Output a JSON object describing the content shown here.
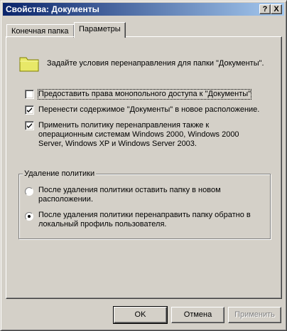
{
  "window": {
    "title": "Свойства: Документы",
    "help_button": "?",
    "close_button": "X"
  },
  "tabs": [
    {
      "label": "Конечная папка",
      "selected": false
    },
    {
      "label": "Параметры",
      "selected": true
    }
  ],
  "header": {
    "icon": "folder-icon",
    "text": "Задайте условия перенаправления для папки \"Документы\"."
  },
  "options": [
    {
      "label": "Предоставить права монопольного доступа к \"Документы\"",
      "checked": false
    },
    {
      "label": "Перенести содержимое \"Документы\" в новое расположение.",
      "checked": true
    },
    {
      "label_lines": [
        "Применить политику перенаправления также к",
        "операционным системам Windows 2000, Windows 2000",
        "Server, Windows XP и Windows Server 2003."
      ],
      "checked": true
    }
  ],
  "policy_removal": {
    "title": "Удаление политики",
    "choices": [
      {
        "label_lines": [
          "После удаления политики оставить папку в новом",
          "расположении."
        ],
        "selected": false
      },
      {
        "label_lines": [
          "После удаления политики перенаправить папку обратно в",
          "локальный профиль пользователя."
        ],
        "selected": true
      }
    ]
  },
  "buttons": {
    "ok": "OK",
    "cancel": "Отмена",
    "apply": "Применить"
  }
}
